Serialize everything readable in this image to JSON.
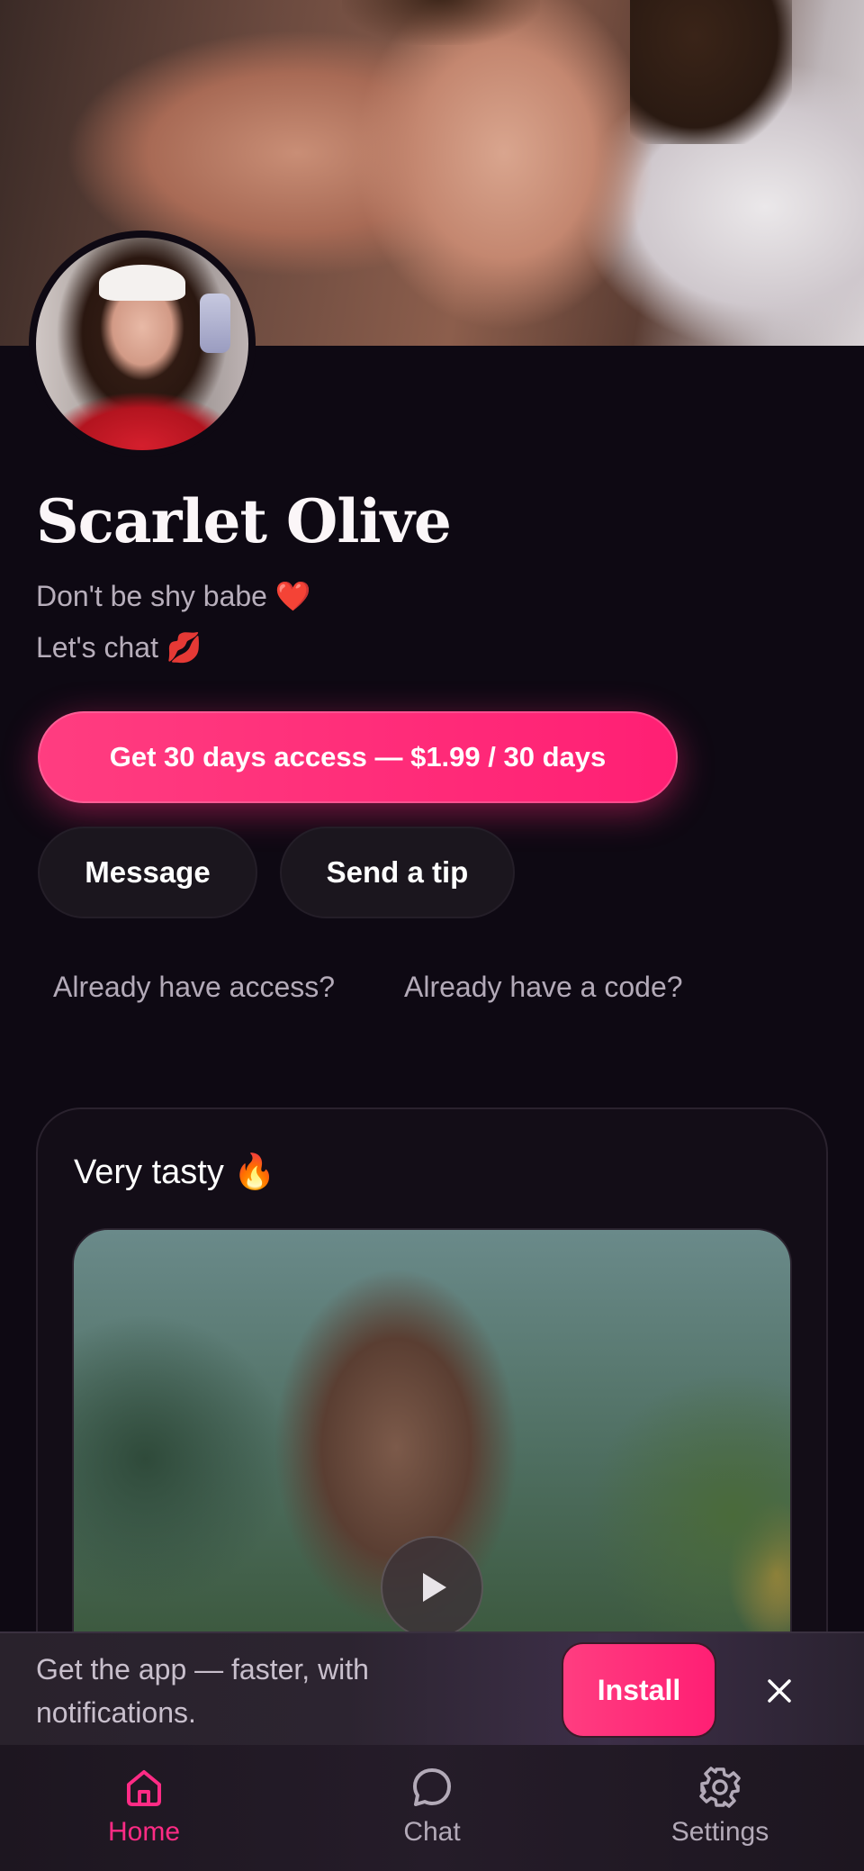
{
  "profile": {
    "name": "Scarlet Olive",
    "bio_line_1": "Don't be shy babe ❤️",
    "bio_line_2": "Let's chat 💋"
  },
  "actions": {
    "subscribe_label": "Get 30 days access — $1.99 / 30 days",
    "message_label": "Message",
    "tip_label": "Send a tip",
    "already_access_label": "Already have access?",
    "already_code_label": "Already have a code?"
  },
  "post": {
    "title": "Very tasty 🔥",
    "media_type": "video"
  },
  "install_banner": {
    "text_line_1": "Get the app — faster, with",
    "text_line_2": "notifications.",
    "install_label": "Install",
    "close_icon": "close-icon"
  },
  "nav": {
    "items": [
      {
        "label": "Home",
        "icon": "home-icon",
        "active": true
      },
      {
        "label": "Chat",
        "icon": "chat-bubble-icon",
        "active": false
      },
      {
        "label": "Settings",
        "icon": "gear-icon",
        "active": false
      }
    ]
  },
  "colors": {
    "accent": "#ff2b85",
    "background": "#0e0913"
  }
}
